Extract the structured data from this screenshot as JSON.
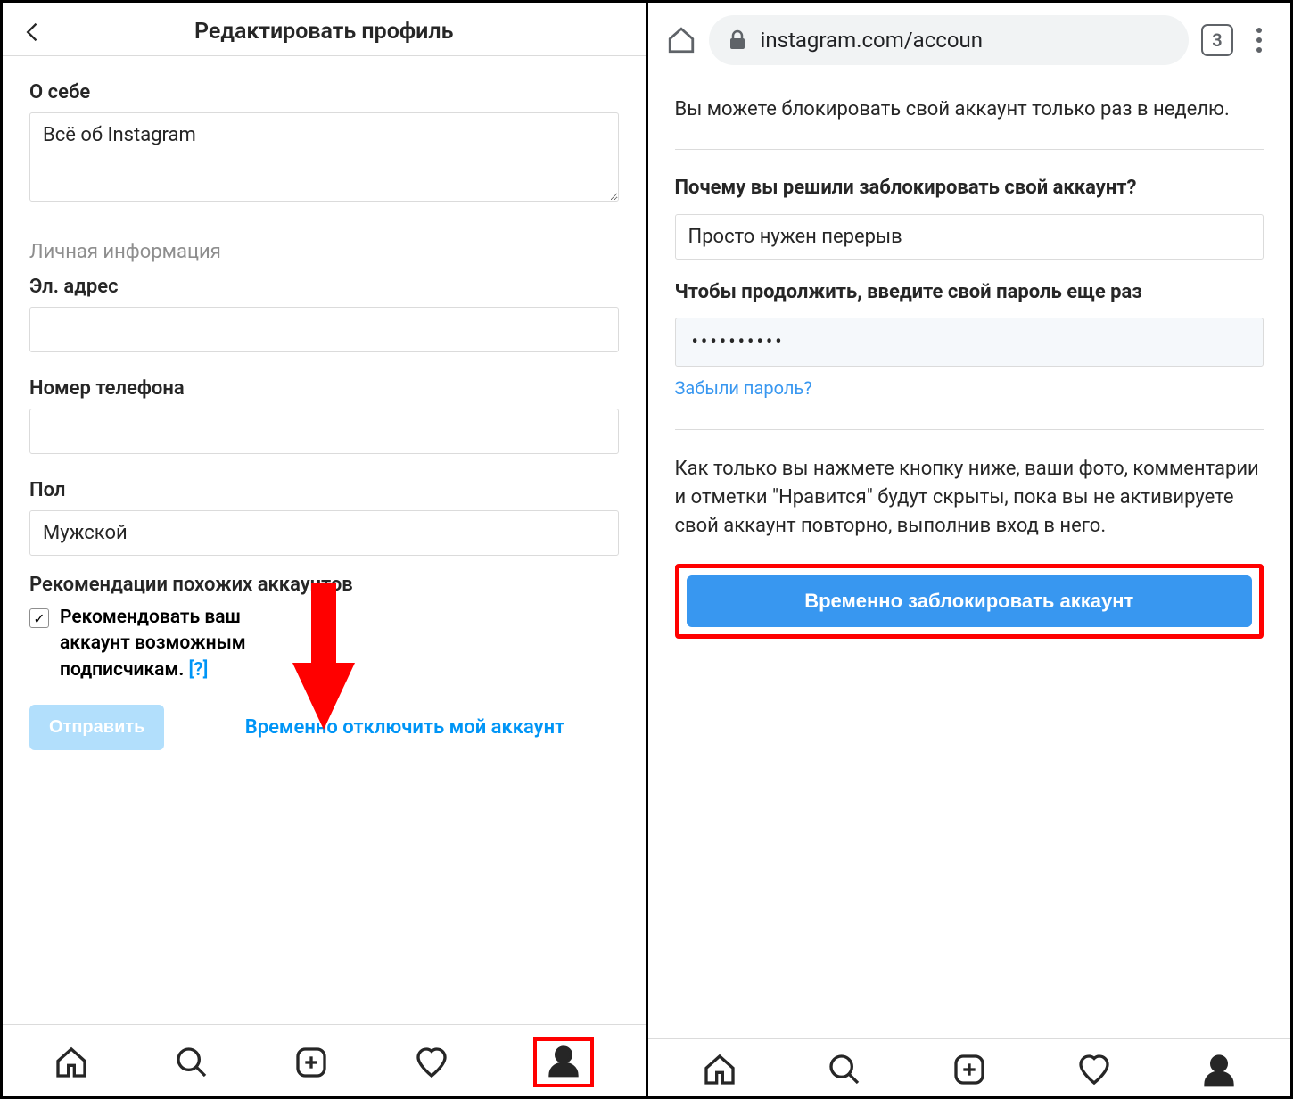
{
  "left": {
    "header_title": "Редактировать профиль",
    "bio_label": "О себе",
    "bio_value": "Всё об Instagram",
    "personal_info_section": "Личная информация",
    "email_label": "Эл. адрес",
    "email_value": "",
    "phone_label": "Номер телефона",
    "phone_value": "",
    "gender_label": "Пол",
    "gender_value": "Мужской",
    "recommend_heading": "Рекомендации похожих аккаунтов",
    "recommend_text": "Рекомендовать ваш аккаунт возможным подписчикам.",
    "recommend_help": "[?]",
    "recommend_checked": true,
    "submit_label": "Отправить",
    "disable_link": "Временно отключить мой аккаунт",
    "arrow_color": "#ff0000"
  },
  "right": {
    "url_display": "instagram.com/accoun",
    "tabs_count": "3",
    "notice_top": "Вы можете блокировать свой аккаунт только раз в неделю.",
    "reason_label": "Почему вы решили заблокировать свой аккаунт?",
    "reason_value": "Просто нужен перерыв",
    "password_label": "Чтобы продолжить, введите свой пароль еще раз",
    "password_mask": "••••••••••",
    "forgot_label": "Забыли пароль?",
    "notice_bottom": "Как только вы нажмете кнопку ниже, ваши фото, комментарии и отметки \"Нравится\" будут скрыты, пока вы не активируете свой аккаунт повторно, выполнив вход в него.",
    "disable_button": "Временно заблокировать аккаунт"
  },
  "colors": {
    "accent": "#0095f6",
    "highlight": "#ff0000",
    "button_blue": "#3897f0"
  }
}
